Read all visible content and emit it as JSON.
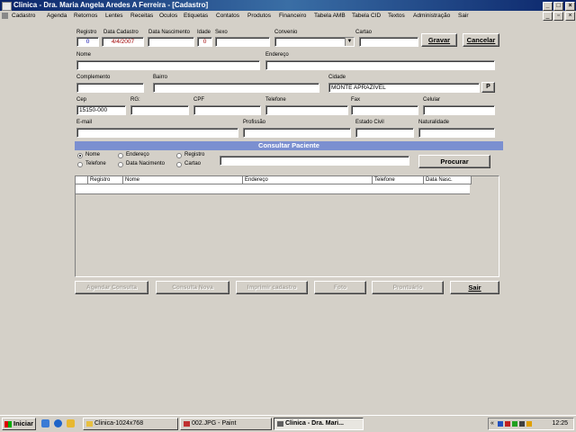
{
  "window": {
    "title": "Clinica - Dra. Maria Angela Aredes A Ferreira - [Cadastro]",
    "btn_min": "_",
    "btn_max": "□",
    "btn_close": "×"
  },
  "menu": [
    "Cadastro",
    "Agenda",
    "Retornos",
    "Lentes",
    "Receitas",
    "Oculos",
    "Etiquetas",
    "Contatos",
    "Produtos",
    "Financeiro",
    "Tabela AMB",
    "Tabela CID",
    "Textos",
    "Administração",
    "Sair"
  ],
  "form": {
    "registro": {
      "label": "Registro",
      "value": "0"
    },
    "data_cadastro": {
      "label": "Data Cadastro",
      "value": "4/4/2007"
    },
    "data_nascimento": {
      "label": "Data Nascimento",
      "value": ""
    },
    "idade": {
      "label": "Idade",
      "value": "0"
    },
    "sexo": {
      "label": "Sexo",
      "value": ""
    },
    "convenio": {
      "label": "Convenio",
      "value": ""
    },
    "cartao": {
      "label": "Cartao",
      "value": ""
    },
    "nome": {
      "label": "Nome",
      "value": ""
    },
    "endereco": {
      "label": "Endereço",
      "value": ""
    },
    "complemento": {
      "label": "Complemento",
      "value": ""
    },
    "bairro": {
      "label": "Bairro",
      "value": ""
    },
    "cidade": {
      "label": "Cidade",
      "value": "MONTE APRAZIVEL"
    },
    "cidade_btn": "P",
    "cep": {
      "label": "Cep",
      "value": "15150-000"
    },
    "rg": {
      "label": "RG:",
      "value": ""
    },
    "cpf": {
      "label": "CPF",
      "value": ""
    },
    "telefone": {
      "label": "Telefone",
      "value": ""
    },
    "fax": {
      "label": "Fax",
      "value": ""
    },
    "celular": {
      "label": "Celular",
      "value": ""
    },
    "email": {
      "label": "E-mail",
      "value": ""
    },
    "profissao": {
      "label": "Profissão",
      "value": ""
    },
    "estado_civil": {
      "label": "Estado Civil",
      "value": ""
    },
    "naturalidade": {
      "label": "Naturalidade",
      "value": ""
    },
    "gravar": "Gravar",
    "cancelar": "Cancelar"
  },
  "consulta": {
    "banner": "Consultar Paciente",
    "options": [
      {
        "label": "Nome",
        "selected": true
      },
      {
        "label": "Endereço",
        "selected": false
      },
      {
        "label": "Registro",
        "selected": false
      },
      {
        "label": "Telefone",
        "selected": false
      },
      {
        "label": "Data Nacimento",
        "selected": false
      },
      {
        "label": "Cartao",
        "selected": false
      }
    ],
    "search_value": "",
    "procurar": "Procurar"
  },
  "grid": {
    "columns": [
      "Registro",
      "Nome",
      "Endereço",
      "Telefone",
      "Data Nasc."
    ]
  },
  "bottom_buttons": {
    "agendar": "Agendar Consulta",
    "consulta_nova": "Consulta Nova",
    "imprimir": "Imprimir cadastro",
    "foto": "Foto",
    "prontuario": "Prontuário",
    "sair": "Sair"
  },
  "taskbar": {
    "start": "Iniciar",
    "tasks": [
      {
        "label": "Clinica-1024x768",
        "active": false
      },
      {
        "label": "002.JPG - Paint",
        "active": false
      },
      {
        "label": "Clinica - Dra. Mari...",
        "active": true
      }
    ],
    "tray_arrow": "«",
    "clock": "12:25"
  }
}
